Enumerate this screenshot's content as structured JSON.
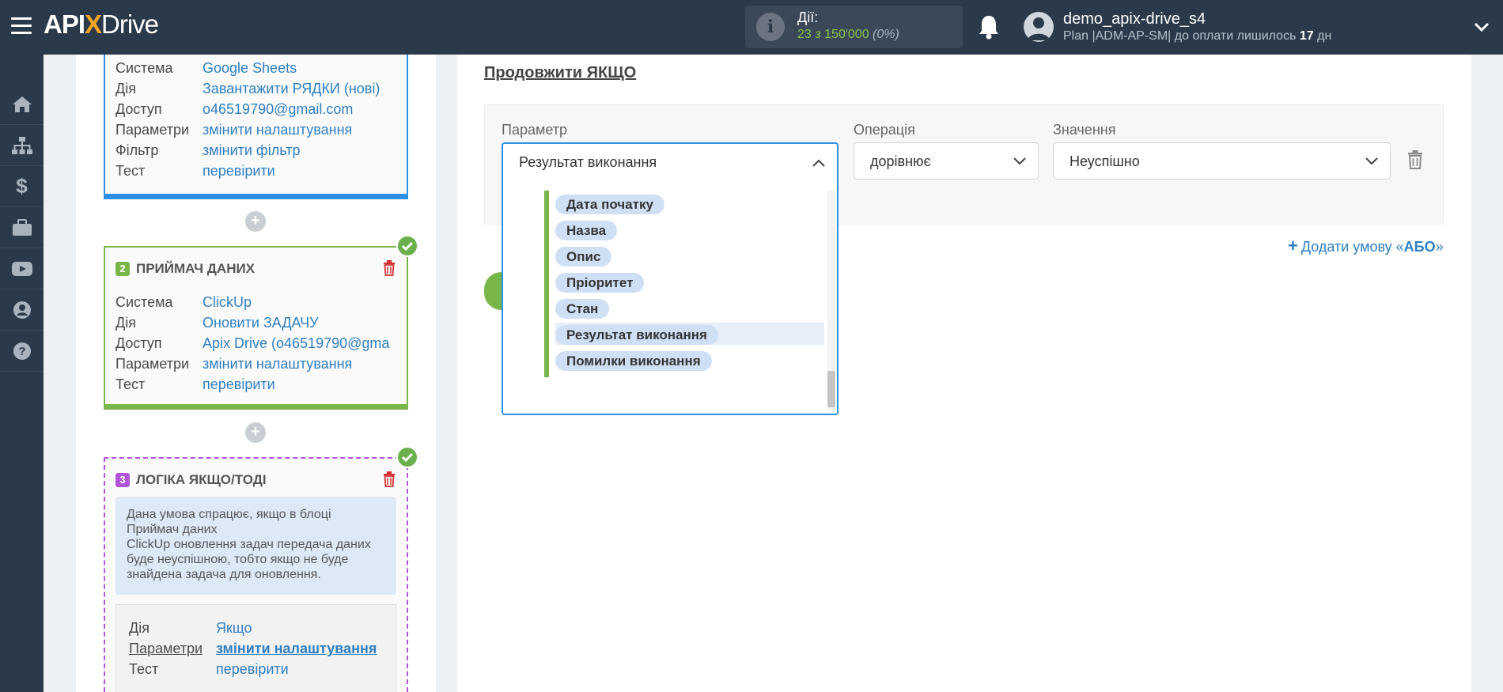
{
  "header": {
    "logo_api": "API",
    "logo_x": "X",
    "logo_drive": "Drive",
    "actions_label": "Дії:",
    "actions_used": "23",
    "actions_of": "з",
    "actions_total": "150'000",
    "actions_pct": "(0%)",
    "user_name": "demo_apix-drive_s4",
    "plan_prefix": "Plan |ADM-AP-SM| до оплати лишилось",
    "plan_days": "17",
    "plan_suffix": "дн"
  },
  "rail": {
    "icons": [
      "home-icon",
      "sitemap-icon",
      "dollar-icon",
      "briefcase-icon",
      "youtube-icon",
      "user-icon",
      "help-icon"
    ]
  },
  "flow": {
    "card1": {
      "rows": [
        {
          "k": "Система",
          "v": "Google Sheets"
        },
        {
          "k": "Дія",
          "v": "Завантажити РЯДКИ (нові)"
        },
        {
          "k": "Доступ",
          "v": "o46519790@gmail.com"
        },
        {
          "k": "Параметри",
          "v": "змінити налаштування"
        },
        {
          "k": "Фільтр",
          "v": "змінити фільтр"
        },
        {
          "k": "Тест",
          "v": "перевірити"
        }
      ]
    },
    "card2": {
      "number": "2",
      "title": "ПРИЙМАЧ ДАНИХ",
      "rows": [
        {
          "k": "Система",
          "v": "ClickUp"
        },
        {
          "k": "Дія",
          "v": "Оновити ЗАДАЧУ"
        },
        {
          "k": "Доступ",
          "v": "Apix Drive (o46519790@gma"
        },
        {
          "k": "Параметри",
          "v": "змінити налаштування"
        },
        {
          "k": "Тест",
          "v": "перевірити"
        }
      ]
    },
    "card3": {
      "number": "3",
      "title": "ЛОГІКА ЯКЩО/ТОДІ",
      "note_lines": [
        "Дана умова спрацює, якщо в блоці",
        "Приймач даних",
        "ClickUp оновлення задач передача даних",
        "буде неуспішною, тобто якщо не буде",
        "знайдена задача для оновлення."
      ],
      "rows": [
        {
          "k": "Дія",
          "v": "Якщо"
        },
        {
          "k": "Параметри",
          "v": "змінити налаштування"
        },
        {
          "k": "Тест",
          "v": "перевірити"
        }
      ]
    },
    "plus": "+"
  },
  "main": {
    "section_title": "Продовжити ЯКЩО",
    "param_label": "Параметр",
    "operation_label": "Операція",
    "value_label": "Значення",
    "param_value": "Результат виконання",
    "operation_value": "дорівнює",
    "value_value": "Неуспішно",
    "dropdown_options": [
      "Дата початку",
      "Назва",
      "Опис",
      "Пріоритет",
      "Стан",
      "Результат виконання",
      "Помилки виконання"
    ],
    "selected_option": "Результат виконання",
    "add_or_prefix": "Додати умову «",
    "add_or_bold": "АБО",
    "add_or_suffix": "»"
  },
  "colors": {
    "topbar": "#2b3a4a",
    "accent_blue": "#2d8fe6",
    "accent_green": "#78b64a",
    "accent_purple": "#b055d9",
    "link": "#2f7fc1",
    "danger": "#d32f2f"
  }
}
